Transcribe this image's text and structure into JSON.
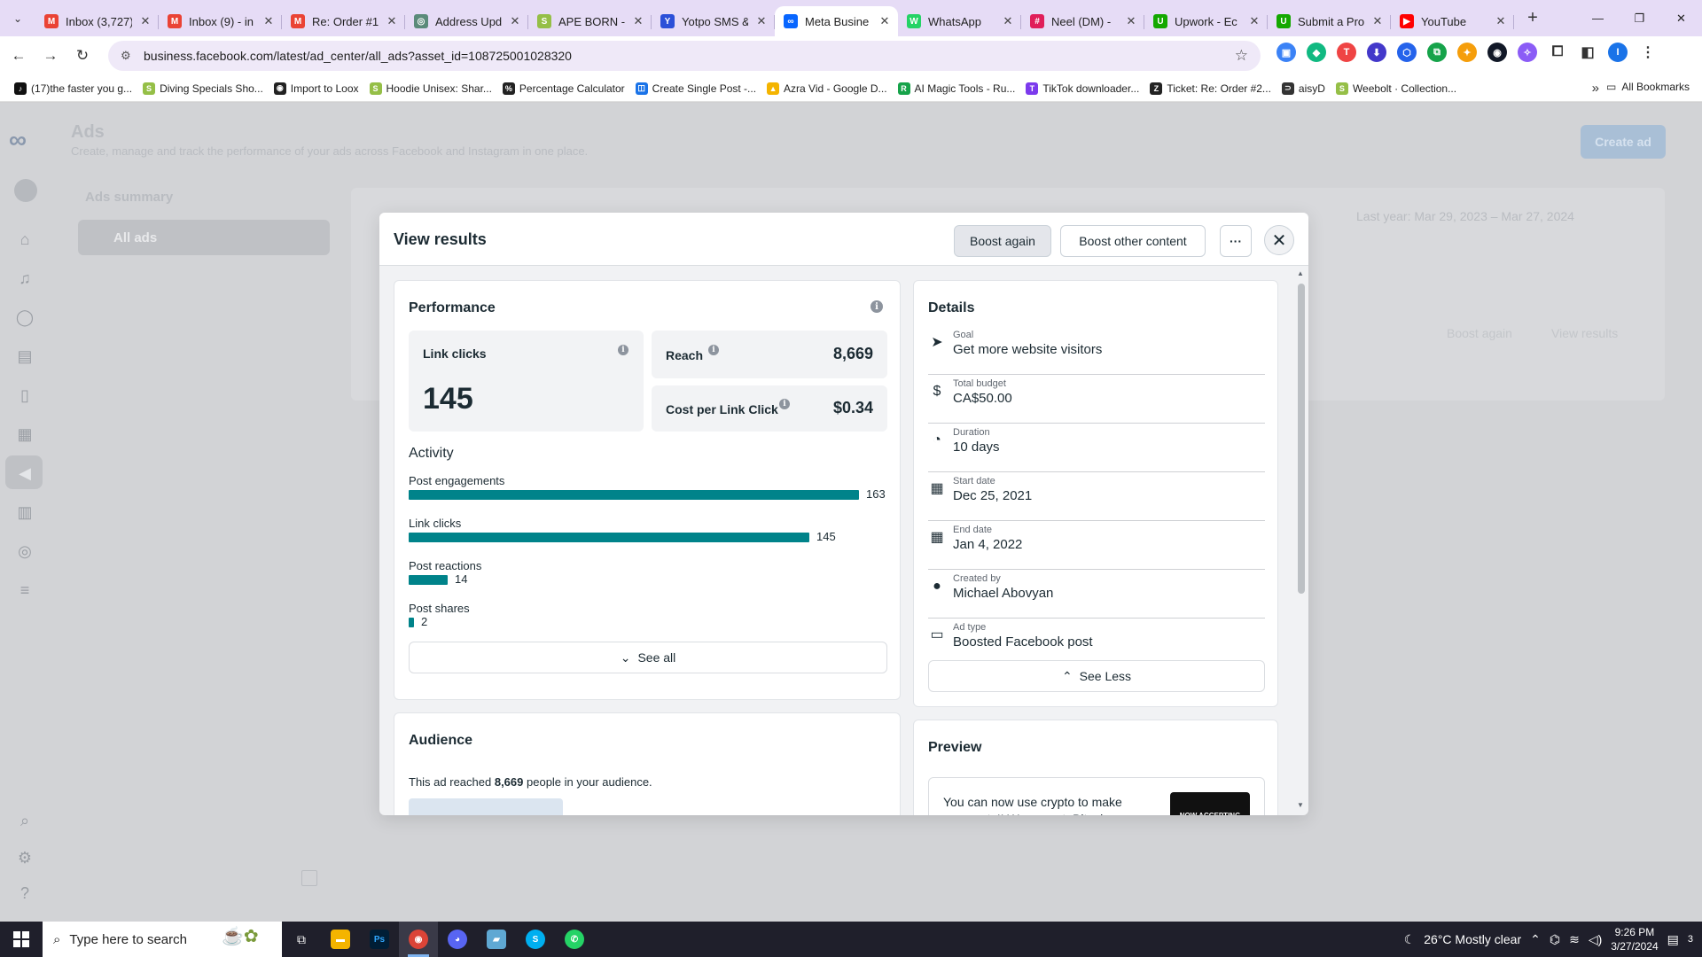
{
  "browser": {
    "tabs": [
      {
        "title": "Inbox (3,727)",
        "icon": "gmail-icon",
        "color": "#ea4335",
        "glyph": "M"
      },
      {
        "title": "Inbox (9) - in",
        "icon": "gmail-icon",
        "color": "#ea4335",
        "glyph": "M"
      },
      {
        "title": "Re: Order #1",
        "icon": "gmail-icon",
        "color": "#ea4335",
        "glyph": "M"
      },
      {
        "title": "Address Upd",
        "icon": "shopify-icon",
        "color": "#5b8b7a",
        "glyph": "◎"
      },
      {
        "title": "APE BORN -",
        "icon": "shopify-icon",
        "color": "#95bf47",
        "glyph": "S"
      },
      {
        "title": "Yotpo SMS &",
        "icon": "yotpo-icon",
        "color": "#2b50d8",
        "glyph": "Y"
      },
      {
        "title": "Meta Busine",
        "icon": "meta-icon",
        "color": "#0866ff",
        "glyph": "∞",
        "active": true
      },
      {
        "title": "WhatsApp",
        "icon": "whatsapp-icon",
        "color": "#25d366",
        "glyph": "W"
      },
      {
        "title": "Neel (DM) -",
        "icon": "slack-icon",
        "color": "#e01e5a",
        "glyph": "#"
      },
      {
        "title": "Upwork - Ec",
        "icon": "upwork-icon",
        "color": "#14a800",
        "glyph": "U"
      },
      {
        "title": "Submit a Pro",
        "icon": "upwork-icon",
        "color": "#14a800",
        "glyph": "U"
      },
      {
        "title": "YouTube",
        "icon": "youtube-icon",
        "color": "#ff0000",
        "glyph": "▶"
      }
    ],
    "url": "business.facebook.com/latest/ad_center/all_ads?asset_id=108725001028320",
    "bookmarks": [
      {
        "label": "(17)the faster you g...",
        "color": "#111111",
        "glyph": "♪"
      },
      {
        "label": "Diving Specials Sho...",
        "color": "#95bf47",
        "glyph": "S"
      },
      {
        "label": "Import to Loox",
        "color": "#222222",
        "glyph": "◉"
      },
      {
        "label": "Hoodie Unisex: Shar...",
        "color": "#95bf47",
        "glyph": "S"
      },
      {
        "label": "Percentage Calculator",
        "color": "#222222",
        "glyph": "%"
      },
      {
        "label": "Create Single Post -...",
        "color": "#1a73e8",
        "glyph": "◫"
      },
      {
        "label": "Azra Vid - Google D...",
        "color": "#f4b400",
        "glyph": "▲"
      },
      {
        "label": "AI Magic Tools - Ru...",
        "color": "#16a34a",
        "glyph": "R"
      },
      {
        "label": "TikTok downloader...",
        "color": "#7c3aed",
        "glyph": "T"
      },
      {
        "label": "Ticket: Re: Order #2...",
        "color": "#222222",
        "glyph": "Z"
      },
      {
        "label": "aisyD",
        "color": "#333333",
        "glyph": "⊃"
      },
      {
        "label": "Weebolt · Collection...",
        "color": "#95bf47",
        "glyph": "S"
      }
    ],
    "all_bookmarks": "All Bookmarks"
  },
  "page": {
    "title": "Ads",
    "subtitle": "Create, manage and track the performance of your ads across Facebook and Instagram in one place.",
    "create_ad": "Create ad",
    "ads_summary": "Ads summary",
    "all_ads": "All ads",
    "date_range": "Last year: Mar 29, 2023 – Mar 27, 2024",
    "bg_boost_again": "Boost again",
    "bg_view_results": "View results"
  },
  "modal": {
    "title": "View results",
    "boost_again": "Boost again",
    "boost_other": "Boost other content",
    "more": "···",
    "performance": {
      "title": "Performance",
      "link_clicks_label": "Link clicks",
      "link_clicks_value": "145",
      "reach_label": "Reach",
      "reach_value": "8,669",
      "cpc_label": "Cost per Link Click",
      "cpc_value": "$0.34"
    },
    "activity": {
      "title": "Activity",
      "max": 163,
      "rows": [
        {
          "label": "Post engagements",
          "value": 163
        },
        {
          "label": "Link clicks",
          "value": 145
        },
        {
          "label": "Post reactions",
          "value": 14
        },
        {
          "label": "Post shares",
          "value": 2
        }
      ],
      "see_all": "See all"
    },
    "details": {
      "title": "Details",
      "rows": [
        {
          "caption": "Goal",
          "value": "Get more website visitors",
          "icon": "cursor-icon"
        },
        {
          "caption": "Total budget",
          "value": "CA$50.00",
          "icon": "dollar-icon"
        },
        {
          "caption": "Duration",
          "value": "10 days",
          "icon": "clock-icon"
        },
        {
          "caption": "Start date",
          "value": "Dec 25, 2021",
          "icon": "calendar-icon"
        },
        {
          "caption": "End date",
          "value": "Jan 4, 2022",
          "icon": "calendar-icon"
        },
        {
          "caption": "Created by",
          "value": "Michael Abovyan",
          "icon": "person-icon"
        },
        {
          "caption": "Ad type",
          "value": "Boosted Facebook post",
          "icon": "post-icon"
        }
      ],
      "see_less": "See Less"
    },
    "audience": {
      "title": "Audience",
      "text_pre": "This ad reached ",
      "text_count": "8,669",
      "text_post": " people in your audience."
    },
    "preview": {
      "title": "Preview",
      "text": "You can now use crypto to make payments!! We accept: Bitcoin Bitcoin",
      "thumb_text": "NOW ACCEPTING CRYPTOCURRENCY"
    }
  },
  "taskbar": {
    "search_placeholder": "Type here to search",
    "weather": "26°C  Mostly clear",
    "time": "9:26 PM",
    "date": "3/27/2024",
    "notif_count": "3"
  }
}
